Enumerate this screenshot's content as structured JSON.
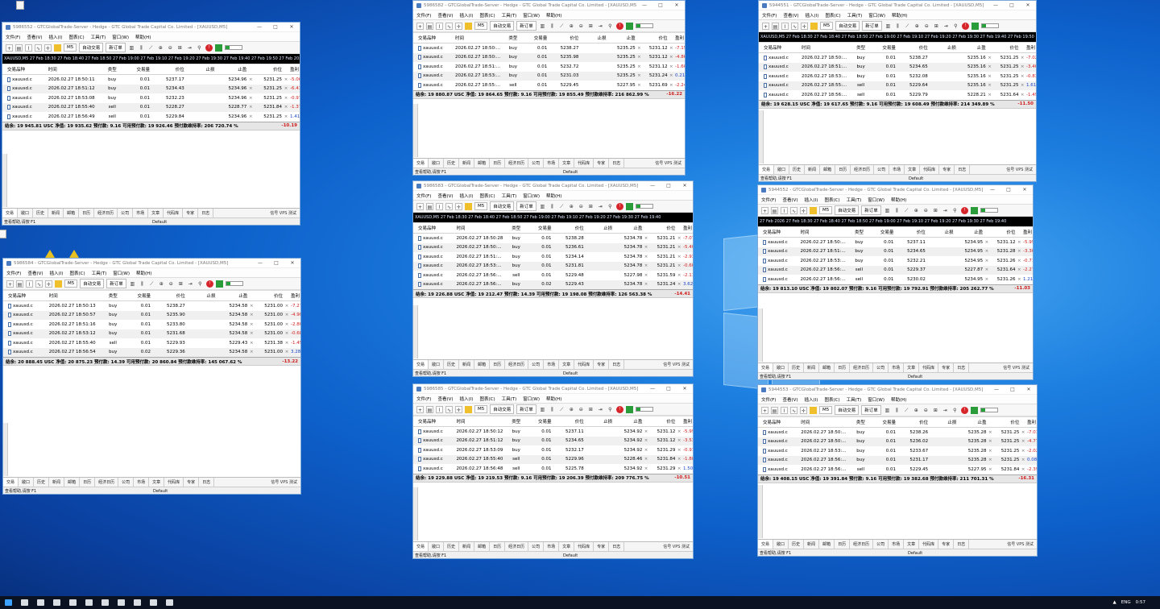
{
  "taskbar": {
    "lang": "ENG",
    "time": "0:57"
  },
  "windows": [
    {
      "title": "5986552 - GTCGlobalTrade-Server - Hedge - GTC Global Trade Capital Co. Limited - [XAUUSD,M5]",
      "menu": [
        "文件(F)",
        "查看(V)",
        "插入(I)",
        "图表(C)",
        "工具(T)",
        "窗口(W)",
        "帮助(H)"
      ],
      "toolbar": {
        "new_order": "新订单",
        "auto_trade": "自动交易",
        "timeframe": "M5"
      },
      "chart_strip": "XAUUSD,M5  27 Feb 18:30  27 Feb 18:40  27 Feb 18:50  27 Feb 19:00  27 Feb 19:10  27 Feb 19:20  27 Feb 19:30  27 Feb 19:40  27 Feb 19:50  27 Feb 20:00",
      "headers": [
        "交易品种",
        "时间",
        "类型",
        "交易量",
        "价位",
        "止损",
        "止盈",
        "价位",
        "盈利"
      ],
      "rows": [
        [
          "xauusd.c",
          "2026.02.27 18:50:11",
          "buy",
          "0.01",
          "5237.17",
          "",
          "5234.96",
          "5231.25",
          "-5.06"
        ],
        [
          "xauusd.c",
          "2026.02.27 18:51:12",
          "buy",
          "0.01",
          "5234.43",
          "",
          "5234.96",
          "5231.25",
          "-6.43"
        ],
        [
          "xauusd.c",
          "2026.02.27 18:53:08",
          "buy",
          "0.01",
          "5232.23",
          "",
          "5234.96",
          "5231.25",
          "-0.97"
        ],
        [
          "xauusd.c",
          "2026.02.27 18:55:40",
          "sell",
          "0.01",
          "5228.27",
          "",
          "5228.77",
          "5231.84",
          "-1.37"
        ],
        [
          "xauusd.c",
          "2026.02.27 18:56:49",
          "sell",
          "0.01",
          "5229.84",
          "",
          "5234.96",
          "5231.25",
          "1.41"
        ]
      ],
      "balance": "结余: 19 945.81 USC  净值: 19 935.62  预付款: 9.16  可用预付款: 19 926.46  预付款维持率: 206 720.74 %",
      "balance_pnl": "-10.19",
      "tabs": [
        "交易",
        "敞口",
        "历史",
        "新闻",
        "邮箱",
        "日历",
        "经济日历",
        "公司",
        "市场",
        "文章",
        "代码库",
        "专家",
        "日志"
      ],
      "tabs_right": "信号  VPS  测试",
      "status_help": "查看帮助,请按 F1",
      "status_profile": "Default"
    },
    {
      "title": "5986584 - GTCGlobalTrade-Server - Hedge - GTC Global Trade Capital Co. Limited - [XAUUSD,M5]",
      "menu": [
        "文件(F)",
        "查看(V)",
        "插入(I)",
        "图表(C)",
        "工具(T)",
        "窗口(W)",
        "帮助(H)"
      ],
      "toolbar": {
        "new_order": "新订单",
        "auto_trade": "自动交易",
        "timeframe": "M5"
      },
      "headers": [
        "交易品种",
        "时间",
        "类型",
        "交易量",
        "价位",
        "止损",
        "止盈",
        "价位",
        "盈利"
      ],
      "rows": [
        [
          "xauusd.c",
          "2026.02.27 18:50:13",
          "buy",
          "0.01",
          "5238.27",
          "",
          "5234.58",
          "5231.00",
          "-7.27"
        ],
        [
          "xauusd.c",
          "2026.02.27 18:50:57",
          "buy",
          "0.01",
          "5235.90",
          "",
          "5234.58",
          "5231.00",
          "-4.90"
        ],
        [
          "xauusd.c",
          "2026.02.27 18:51:16",
          "buy",
          "0.01",
          "5233.80",
          "",
          "5234.58",
          "5231.00",
          "-2.80"
        ],
        [
          "xauusd.c",
          "2026.02.27 18:53:12",
          "buy",
          "0.01",
          "5231.68",
          "",
          "5234.58",
          "5231.00",
          "-0.68"
        ],
        [
          "xauusd.c",
          "2026.02.27 18:55:40",
          "sell",
          "0.01",
          "5229.93",
          "",
          "5229.43",
          "5231.38",
          "-1.45"
        ],
        [
          "xauusd.c",
          "2026.02.27 18:56:54",
          "buy",
          "0.02",
          "5229.36",
          "",
          "5234.58",
          "5231.00",
          "3.28"
        ]
      ],
      "balance": "结余: 20 888.45 USC  净值: 20 875.23  预付款: 14.39  可用预付款: 20 860.84  预付款维持率: 145 067.62 %",
      "balance_pnl": "-13.22",
      "tabs": [
        "交易",
        "敞口",
        "历史",
        "新闻",
        "邮箱",
        "日历",
        "经济日历",
        "公司",
        "市场",
        "文章",
        "代码库",
        "专家",
        "日志"
      ],
      "tabs_right": "信号  VPS  测试",
      "status_help": "查看帮助,请按 F1",
      "status_profile": "Default"
    },
    {
      "title": "5986582 - GTCGlobalTrade-Server - Hedge - GTC Global Trade Capital Co. Limited - [XAUUSD,M5]",
      "menu": [
        "文件(F)",
        "查看(V)",
        "插入(I)",
        "图表(C)",
        "工具(T)",
        "窗口(W)",
        "帮助(H)"
      ],
      "toolbar": {
        "new_order": "新订单",
        "auto_trade": "自动交易",
        "timeframe": "M5"
      },
      "headers": [
        "交易品种",
        "时间",
        "类型",
        "交易量",
        "价位",
        "止损",
        "止盈",
        "价位",
        "盈利"
      ],
      "rows": [
        [
          "xauusd.c",
          "2026.02.27 18:50:...",
          "buy",
          "0.01",
          "5238.27",
          "",
          "5235.25",
          "5231.12",
          "-7.15"
        ],
        [
          "xauusd.c",
          "2026.02.27 18:50:...",
          "buy",
          "0.01",
          "5235.98",
          "",
          "5235.25",
          "5231.12",
          "-4.86"
        ],
        [
          "xauusd.c",
          "2026.02.27 18:51:...",
          "buy",
          "0.01",
          "5232.72",
          "",
          "5235.25",
          "5231.12",
          "-1.60"
        ],
        [
          "xauusd.c",
          "2026.02.27 18:53:...",
          "buy",
          "0.01",
          "5231.03",
          "",
          "5235.25",
          "5231.24",
          "0.21"
        ],
        [
          "xauusd.c",
          "2026.02.27 18:55:...",
          "sell",
          "0.01",
          "5229.45",
          "",
          "5227.95",
          "5231.69",
          "-2.24"
        ]
      ],
      "balance": "结余: 19 880.87 USC  净值: 19 864.65  预付款: 9.16  可用预付款: 19 855.49  预付款维持率: 216 862.99 %",
      "balance_pnl": "-16.22",
      "tabs": [
        "交易",
        "敞口",
        "历史",
        "新闻",
        "邮箱",
        "日历",
        "经济日历",
        "公司",
        "市场",
        "文章",
        "代码库",
        "专家",
        "日志"
      ],
      "tabs_right": "信号  VPS  测试",
      "status_help": "查看帮助,请按 F1",
      "status_profile": "Default"
    },
    {
      "title": "5986583 - GTCGlobalTrade-Server - Hedge - GTC Global Trade Capital Co. Limited - [XAUUSD,M5]",
      "menu": [
        "文件(F)",
        "查看(V)",
        "插入(I)",
        "图表(C)",
        "工具(T)",
        "窗口(W)",
        "帮助(H)"
      ],
      "toolbar": {
        "new_order": "新订单",
        "auto_trade": "自动交易",
        "timeframe": "M5"
      },
      "chart_strip": "XAUUSD,M5  27 Feb 18:30  27 Feb 18:40  27 Feb 18:50  27 Feb 19:00  27 Feb 19:10  27 Feb 19:20  27 Feb 19:30  27 Feb 19:40",
      "headers": [
        "交易品种",
        "时间",
        "类型",
        "交易量",
        "价位",
        "止损",
        "止盈",
        "价位",
        "盈利"
      ],
      "rows": [
        [
          "xauusd.c",
          "2026.02.27 18:50:28",
          "buy",
          "0.01",
          "5238.28",
          "",
          "5234.78",
          "5231.21",
          "-7.07"
        ],
        [
          "xauusd.c",
          "2026.02.27 18:50:...",
          "buy",
          "0.01",
          "5236.61",
          "",
          "5234.78",
          "5231.21",
          "-5.40"
        ],
        [
          "xauusd.c",
          "2026.02.27 18:51:...",
          "buy",
          "0.01",
          "5234.14",
          "",
          "5234.78",
          "5231.21",
          "-2.93"
        ],
        [
          "xauusd.c",
          "2026.02.27 18:53:...",
          "buy",
          "0.01",
          "5231.81",
          "",
          "5234.78",
          "5231.21",
          "-0.60"
        ],
        [
          "xauusd.c",
          "2026.02.27 18:56:...",
          "sell",
          "0.01",
          "5229.48",
          "",
          "5227.98",
          "5231.59",
          "-2.11"
        ],
        [
          "xauusd.c",
          "2026.02.27 18:56:...",
          "buy",
          "0.02",
          "5229.43",
          "",
          "5234.78",
          "5231.24",
          "3.62"
        ]
      ],
      "balance": "结余: 19 226.88 USC  净值: 19 212.47  预付款: 14.39  可用预付款: 19 198.08  预付款维持率: 126 563.38 %",
      "balance_pnl": "-14.41",
      "tabs": [
        "交易",
        "敞口",
        "历史",
        "新闻",
        "邮箱",
        "日历",
        "经济日历",
        "公司",
        "市场",
        "文章",
        "代码库",
        "专家",
        "日志"
      ],
      "tabs_right": "信号  VPS  测试",
      "status_help": "查看帮助,请按 F1",
      "status_profile": "Default"
    },
    {
      "title": "5986585 - GTCGlobalTrade-Server - Hedge - GTC Global Trade Capital Co. Limited - [XAUUSD,M5]",
      "menu": [
        "文件(F)",
        "查看(V)",
        "插入(I)",
        "图表(C)",
        "工具(T)",
        "窗口(W)",
        "帮助(H)"
      ],
      "toolbar": {
        "new_order": "新订单",
        "auto_trade": "自动交易",
        "timeframe": "M5"
      },
      "headers": [
        "交易品种",
        "时间",
        "类型",
        "交易量",
        "价位",
        "止损",
        "止盈",
        "价位",
        "盈利"
      ],
      "rows": [
        [
          "xauusd.c",
          "2026.02.27 18:50:12",
          "buy",
          "0.01",
          "5237.11",
          "",
          "5234.92",
          "5231.12",
          "-5.99"
        ],
        [
          "xauusd.c",
          "2026.02.27 18:51:12",
          "buy",
          "0.01",
          "5234.65",
          "",
          "5234.92",
          "5231.12",
          "-3.53"
        ],
        [
          "xauusd.c",
          "2026.02.27 18:53:09",
          "buy",
          "0.01",
          "5232.17",
          "",
          "5234.92",
          "5231.29",
          "-0.91"
        ],
        [
          "xauusd.c",
          "2026.02.27 18:55:40",
          "sell",
          "0.01",
          "5229.96",
          "",
          "5228.46",
          "5231.84",
          "-1.88"
        ],
        [
          "xauusd.c",
          "2026.02.27 18:56:48",
          "sell",
          "0.01",
          "5225.78",
          "",
          "5234.92",
          "5231.29",
          "1.50"
        ]
      ],
      "balance": "结余: 19 229.88 USC  净值: 19 219.53  预付款: 9.16  可用预付款: 19 206.39  预付款维持率: 209 776.75 %",
      "balance_pnl": "-10.51",
      "tabs": [
        "交易",
        "敞口",
        "历史",
        "新闻",
        "邮箱",
        "日历",
        "经济日历",
        "公司",
        "市场",
        "文章",
        "代码库",
        "专家",
        "日志"
      ],
      "tabs_right": "信号  VPS  测试",
      "status_help": "查看帮助,请按 F1",
      "status_profile": "Default"
    },
    {
      "title": "5944551 - GTCGlobalTrade-Server - Hedge - GTC Global Trade Capital Co. Limited - [XAUUSD,M5]",
      "menu": [
        "文件(F)",
        "查看(V)",
        "插入(I)",
        "图表(C)",
        "工具(T)",
        "窗口(W)",
        "帮助(H)"
      ],
      "toolbar": {
        "new_order": "新订单",
        "auto_trade": "自动交易",
        "timeframe": "M5"
      },
      "chart_strip": "XAUUSD,M5  27 Feb 18:30  27 Feb 18:40  27 Feb 18:50  27 Feb 19:00  27 Feb 19:10  27 Feb 19:20  27 Feb 19:30  27 Feb 19:40  27 Feb 19:50",
      "headers": [
        "交易品种",
        "时间",
        "类型",
        "交易量",
        "价位",
        "止损",
        "止盈",
        "价位",
        "盈利"
      ],
      "rows": [
        [
          "xauusd.c",
          "2026.02.27 18:50:...",
          "buy",
          "0.01",
          "5238.27",
          "",
          "5235.16",
          "5231.25",
          "-7.02"
        ],
        [
          "xauusd.c",
          "2026.02.27 18:51:...",
          "buy",
          "0.01",
          "5234.65",
          "",
          "5235.16",
          "5231.25",
          "-3.40"
        ],
        [
          "xauusd.c",
          "2026.02.27 18:53:...",
          "buy",
          "0.01",
          "5232.08",
          "",
          "5235.16",
          "5231.25",
          "-0.83"
        ],
        [
          "xauusd.c",
          "2026.02.27 18:55:...",
          "sell",
          "0.01",
          "5229.64",
          "",
          "5235.16",
          "5231.25",
          "1.61"
        ],
        [
          "xauusd.c",
          "2026.02.27 18:56:...",
          "sell",
          "0.01",
          "5229.79",
          "",
          "5228.21",
          "5231.64",
          "-1.49"
        ]
      ],
      "balance": "结余: 19 628.15 USC  净值: 19 617.65  预付款: 9.16  可用预付款: 19 608.49  预付款维持率: 214 349.89 %",
      "balance_pnl": "-11.50",
      "tabs": [
        "交易",
        "敞口",
        "历史",
        "新闻",
        "邮箱",
        "日历",
        "经济日历",
        "公司",
        "市场",
        "文章",
        "代码库",
        "专家",
        "日志"
      ],
      "tabs_right": "信号  VPS  测试",
      "status_help": "查看帮助,请按 F1",
      "status_profile": "Default"
    },
    {
      "title": "5944552 - GTCGlobalTrade-Server - Hedge - GTC Global Trade Capital Co. Limited - [XAUUSD,M5]",
      "menu": [
        "文件(F)",
        "查看(V)",
        "插入(I)",
        "图表(C)",
        "工具(T)",
        "窗口(W)",
        "帮助(H)"
      ],
      "toolbar": {
        "new_order": "新订单",
        "auto_trade": "自动交易",
        "timeframe": "M5"
      },
      "chart_strip": "27 Feb 2026  27 Feb 18:30  27 Feb 18:40  27 Feb 18:50  27 Feb 19:00  27 Feb 19:10  27 Feb 19:20  27 Feb 19:30  27 Feb 19:40",
      "headers": [
        "交易品种",
        "时间",
        "类型",
        "交易量",
        "价位",
        "止损",
        "止盈",
        "价位",
        "盈利"
      ],
      "rows": [
        [
          "xauusd.c",
          "2026.02.27 18:50:...",
          "buy",
          "0.01",
          "5237.11",
          "",
          "5234.95",
          "5231.12",
          "-5.99"
        ],
        [
          "xauusd.c",
          "2026.02.27 18:51:...",
          "buy",
          "0.01",
          "5234.65",
          "",
          "5234.95",
          "5231.28",
          "-3.30"
        ],
        [
          "xauusd.c",
          "2026.02.27 18:53:...",
          "buy",
          "0.01",
          "5232.21",
          "",
          "5234.95",
          "5231.26",
          "-0.71"
        ],
        [
          "xauusd.c",
          "2026.02.27 18:56:...",
          "sell",
          "0.01",
          "5229.37",
          "",
          "5227.87",
          "5231.64",
          "-2.27"
        ],
        [
          "xauusd.c",
          "2026.02.27 18:56:...",
          "sell",
          "0.01",
          "5230.02",
          "",
          "5234.95",
          "5231.26",
          "1.21"
        ]
      ],
      "balance": "结余: 19 813.10 USC  净值: 19 802.07  预付款: 9.16  可用预付款: 19 792.91  预付款维持率: 205 262.77 %",
      "balance_pnl": "-11.03",
      "tabs": [
        "交易",
        "敞口",
        "历史",
        "新闻",
        "邮箱",
        "日历",
        "经济日历",
        "公司",
        "市场",
        "文章",
        "代码库",
        "专家",
        "日志"
      ],
      "tabs_right": "信号  VPS  测试",
      "status_help": "查看帮助,请按 F1",
      "status_profile": "Default"
    },
    {
      "title": "5944553 - GTCGlobalTrade-Server - Hedge - GTC Global Trade Capital Co. Limited - [XAUUSD,M5]",
      "menu": [
        "文件(F)",
        "查看(V)",
        "插入(I)",
        "图表(C)",
        "工具(T)",
        "窗口(W)",
        "帮助(H)"
      ],
      "toolbar": {
        "new_order": "新订单",
        "auto_trade": "自动交易",
        "timeframe": "M5"
      },
      "headers": [
        "交易品种",
        "时间",
        "类型",
        "交易量",
        "价位",
        "止损",
        "止盈",
        "价位",
        "盈利"
      ],
      "rows": [
        [
          "xauusd.c",
          "2026.02.27 18:50:...",
          "buy",
          "0.01",
          "5238.26",
          "",
          "5235.28",
          "5231.25",
          "-7.01"
        ],
        [
          "xauusd.c",
          "2026.02.27 18:50:...",
          "buy",
          "0.01",
          "5236.02",
          "",
          "5235.28",
          "5231.25",
          "-4.77"
        ],
        [
          "xauusd.c",
          "2026.02.27 18:53:...",
          "buy",
          "0.01",
          "5233.67",
          "",
          "5235.28",
          "5231.25",
          "-2.02"
        ],
        [
          "xauusd.c",
          "2026.02.27 18:56:...",
          "buy",
          "0.01",
          "5231.17",
          "",
          "5235.28",
          "5231.25",
          "0.08"
        ],
        [
          "xauusd.c",
          "2026.02.27 18:56:...",
          "sell",
          "0.01",
          "5229.45",
          "",
          "5227.95",
          "5231.84",
          "-2.39"
        ]
      ],
      "balance": "结余: 19 408.15 USC  净值: 19 391.84  预付款: 9.16  可用预付款: 19 382.68  预付款维持率: 211 701.31 %",
      "balance_pnl": "-16.31",
      "tabs": [
        "交易",
        "敞口",
        "历史",
        "新闻",
        "邮箱",
        "日历",
        "经济日历",
        "公司",
        "市场",
        "文章",
        "代码库",
        "专家",
        "日志"
      ],
      "tabs_right": "信号  VPS  测试",
      "status_help": "查看帮助,请按 F1",
      "status_profile": "Default"
    }
  ]
}
